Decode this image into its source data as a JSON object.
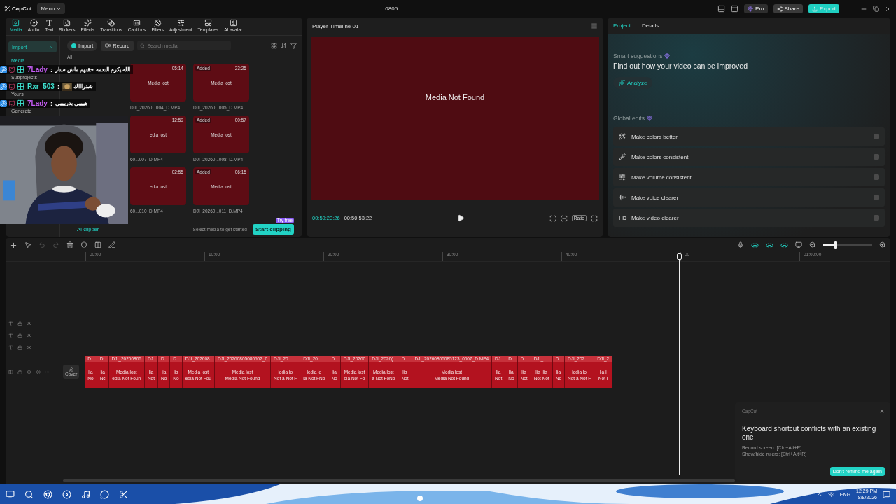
{
  "titlebar": {
    "logo": "CapCut",
    "menu": "Menu",
    "title": "0805",
    "pro": "Pro",
    "share": "Share",
    "export": "Export"
  },
  "toolbar_tabs": [
    {
      "label": "Media",
      "selected": true
    },
    {
      "label": "Audio",
      "selected": false
    },
    {
      "label": "Text",
      "selected": false
    },
    {
      "label": "Stickers",
      "selected": false
    },
    {
      "label": "Effects",
      "selected": false
    },
    {
      "label": "Transitions",
      "selected": false
    },
    {
      "label": "Captions",
      "selected": false
    },
    {
      "label": "Filters",
      "selected": false
    },
    {
      "label": "Adjustment",
      "selected": false
    },
    {
      "label": "Templates",
      "selected": false
    },
    {
      "label": "AI avatar",
      "selected": false
    }
  ],
  "import_dropdown": "Import",
  "sidebar": [
    {
      "label": "Media",
      "selected": true
    },
    {
      "label": "Subprojects",
      "selected": false
    },
    {
      "label": "Yours",
      "selected": false
    },
    {
      "label": "Generate",
      "selected": false
    }
  ],
  "media_actions": {
    "import": "Import",
    "record": "Record",
    "search_placeholder": "Search media"
  },
  "media_filter": "All",
  "media_items": [
    {
      "kind": "hidden"
    },
    {
      "kind": "card",
      "duration": "05:14",
      "label": "Media lost",
      "name": "DJI_20260...004_D.MP4"
    },
    {
      "kind": "card",
      "badge": "Added",
      "duration": "23:25",
      "label": "Media lost",
      "name": "DJI_20260...005_D.MP4"
    },
    {
      "kind": "hidden"
    },
    {
      "kind": "card",
      "duration": "12:59",
      "label": "edia lost",
      "name": "60...007_D.MP4"
    },
    {
      "kind": "card",
      "badge": "Added",
      "duration": "00:57",
      "label": "Media lost",
      "name": "DJI_20260...008_D.MP4"
    },
    {
      "kind": "hidden"
    },
    {
      "kind": "card",
      "duration": "02:55",
      "label": "edia lost",
      "name": "60...010_D.MP4"
    },
    {
      "kind": "card",
      "badge": "Added",
      "duration": "06:15",
      "label": "Media lost",
      "name": "DJI_20260...011_D.MP4"
    }
  ],
  "clipper": {
    "label": "AI clipper",
    "hint": "Select media to get started",
    "button": "Start clipping",
    "badge": "Try free"
  },
  "player": {
    "title": "Player-Timeline 01",
    "message": "Media Not Found",
    "current_time": "00:50:23:26",
    "total_time": "00:50:53:22",
    "ratio": "Ratio"
  },
  "details": {
    "tabs": [
      {
        "label": "Project",
        "selected": true
      },
      {
        "label": "Details",
        "selected": false
      }
    ],
    "suggest_label": "Smart suggestions",
    "suggest_title": "Find out how your video can be improved",
    "analyze": "Analyze",
    "global_label": "Global edits",
    "edits": [
      {
        "label": "Make colors better",
        "on": false
      },
      {
        "label": "Make colors consistent",
        "on": false
      },
      {
        "label": "Make volume consistent",
        "on": false
      },
      {
        "label": "Make voice clearer",
        "on": false
      },
      {
        "label": "Make video clearer",
        "on": false,
        "icon_text": "HD"
      }
    ]
  },
  "timeline": {
    "zoom": {
      "level": 0.25
    },
    "ruler": [
      "00:00",
      "10:00",
      "20:00",
      "30:00",
      "40:00",
      "00",
      "01:00:00"
    ],
    "cover": "Cover",
    "clips": [
      {
        "title": "D",
        "line1": "lia",
        "line2": "No"
      },
      {
        "title": "D",
        "line1": "lia",
        "line2": "Nc"
      },
      {
        "title": "DJI_20260805",
        "line1": "Media lost",
        "line2": "edia Not Foun"
      },
      {
        "title": "DJ",
        "line1": "lia",
        "line2": "Not"
      },
      {
        "title": "D",
        "line1": "lia",
        "line2": "No"
      },
      {
        "title": "D",
        "line1": "lia",
        "line2": "No"
      },
      {
        "title": "DJI_202608",
        "line1": "Media lost",
        "line2": "edia Not Fou"
      },
      {
        "title": "DJI_20260805080502_0",
        "line1": "Media lost",
        "line2": "Media Not Found"
      },
      {
        "title": "DJI_20",
        "line1": "ledia lo",
        "line2": "Not a Not F"
      },
      {
        "title": "DJI_20",
        "line1": "ledia lo",
        "line2": "ia Not FNo"
      },
      {
        "title": "D",
        "line1": "lia",
        "line2": "No"
      },
      {
        "title": "DJI_20260",
        "line1": "Media lost",
        "line2": "dia Not Fo"
      },
      {
        "title": "DJI_2026(",
        "line1": "Media lost",
        "line2": "a Not FoNo"
      },
      {
        "title": "D",
        "line1": "lia",
        "line2": "Not"
      },
      {
        "title": "DJI_20260805085123_0007_D.MP4",
        "line1": "Media lost",
        "line2": "Media Not Found"
      },
      {
        "title": "DJ",
        "line1": "lia",
        "line2": "Not"
      },
      {
        "title": "D",
        "line1": "lia",
        "line2": "No"
      },
      {
        "title": "D",
        "line1": "lia",
        "line2": "Not"
      },
      {
        "title": "DJI_",
        "line1": "lia Ilia",
        "line2": "Not Not"
      },
      {
        "title": "D",
        "line1": "lia",
        "line2": "No"
      },
      {
        "title": "DJI_202",
        "line1": "ledia lo",
        "line2": "Not a Not F"
      },
      {
        "title": "DJI_2",
        "line1": "lia I",
        "line2": "Not I"
      }
    ]
  },
  "chat": {
    "separator": ":",
    "messages": [
      {
        "user": "7Lady",
        "color": "#c45cf2",
        "message": "الله يكرم النعمه حقتهم ماش ستار"
      },
      {
        "user": "Rxr_503",
        "color": "#3ee0cf",
        "message": "شدراااك",
        "emote": true
      },
      {
        "user": "7Lady",
        "color": "#c45cf2",
        "message": "هييييي بدرييييي"
      }
    ]
  },
  "notification": {
    "app": "CapCut",
    "title": "Keyboard shortcut conflicts with an existing one",
    "lines": [
      "Record screen: [Ctrl+Alt+P]",
      "Show/hide rulers: [Ctrl+Alt+R]"
    ],
    "button": "Don't remind me again"
  },
  "taskbar": {
    "lang": "ENG",
    "time": "12:29 PM",
    "date": "8/8/2026"
  }
}
